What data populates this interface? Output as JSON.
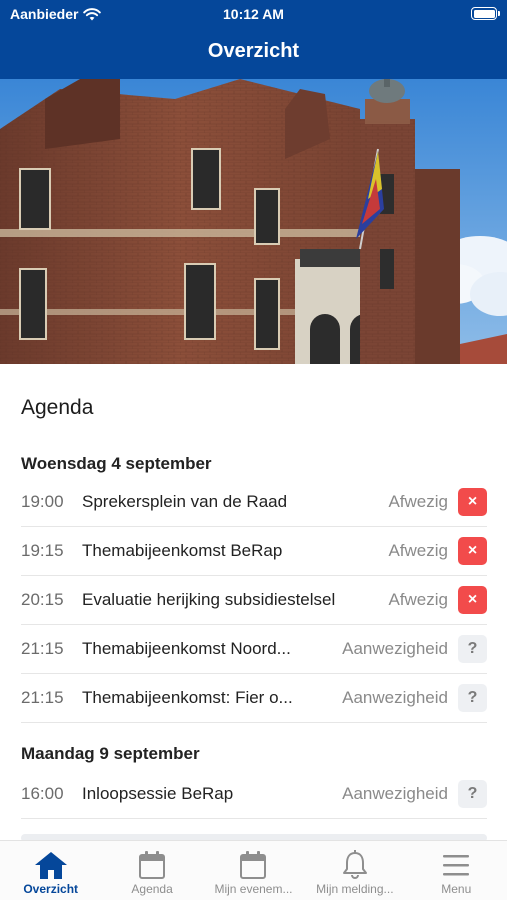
{
  "status_bar": {
    "carrier": "Aanbieder",
    "time": "10:12 AM"
  },
  "nav": {
    "title": "Overzicht"
  },
  "agenda": {
    "title": "Agenda",
    "days": [
      {
        "heading": "Woensdag 4 september",
        "items": [
          {
            "time": "19:00",
            "title": "Sprekersplein van de Raad",
            "status": "Afwezig",
            "badge": "×"
          },
          {
            "time": "19:15",
            "title": "Themabijeenkomst BeRap",
            "status": "Afwezig",
            "badge": "×"
          },
          {
            "time": "20:15",
            "title": "Evaluatie herijking subsidiestelsel",
            "status": "Afwezig",
            "badge": "×"
          },
          {
            "time": "21:15",
            "title": "Themabijeenkomst Noord...",
            "status": "Aanwezigheid",
            "badge": "?"
          },
          {
            "time": "21:15",
            "title": "Themabijeenkomst: Fier o...",
            "status": "Aanwezigheid",
            "badge": "?"
          }
        ]
      },
      {
        "heading": "Maandag 9 september",
        "items": [
          {
            "time": "16:00",
            "title": "Inloopsessie BeRap",
            "status": "Aanwezigheid",
            "badge": "?"
          }
        ]
      }
    ]
  },
  "tabbar": {
    "tabs": [
      {
        "label": "Overzicht",
        "icon": "home-icon",
        "active": true
      },
      {
        "label": "Agenda",
        "icon": "calendar-icon",
        "active": false
      },
      {
        "label": "Mijn evenem...",
        "icon": "calendar-icon",
        "active": false
      },
      {
        "label": "Mijn melding...",
        "icon": "bell-icon",
        "active": false
      },
      {
        "label": "Menu",
        "icon": "hamburger-menu-icon",
        "active": false
      }
    ]
  },
  "colors": {
    "brand": "#05479a",
    "absent_badge": "#f24b4b",
    "unknown_badge": "#eef0f3"
  }
}
